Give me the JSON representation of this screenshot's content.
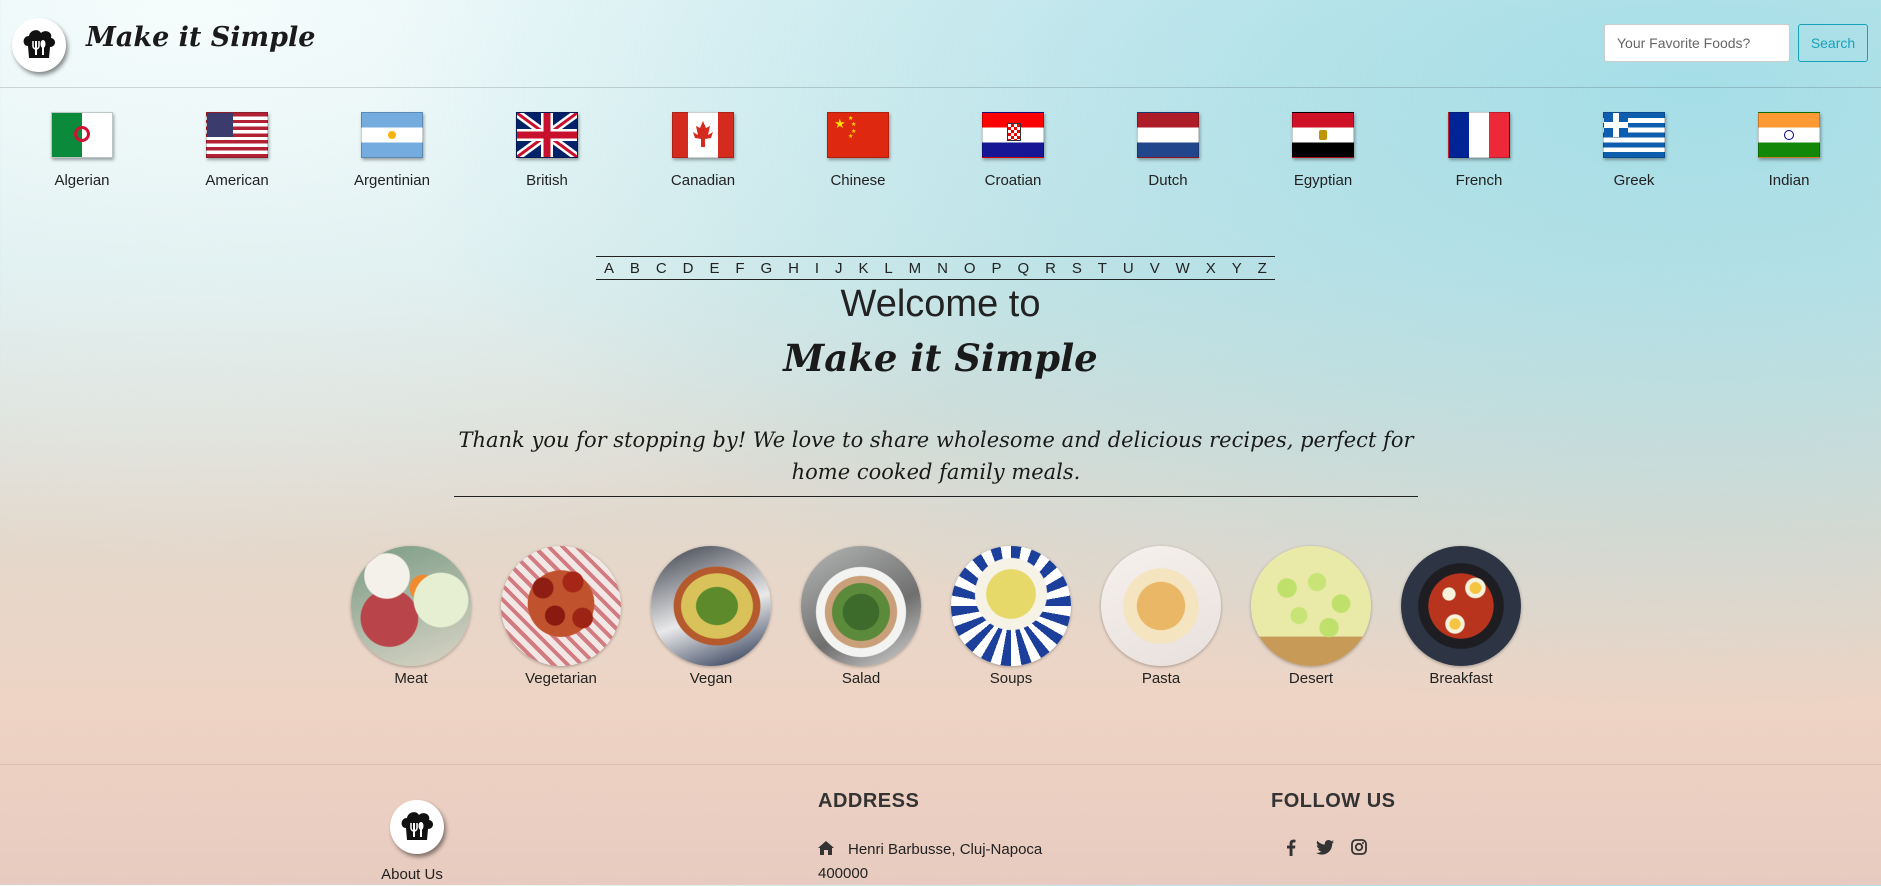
{
  "header": {
    "brand": "Make it Simple",
    "search_placeholder": "Your Favorite Foods?",
    "search_button": "Search"
  },
  "cuisines": [
    {
      "label": "Algerian",
      "flag": "algeria-flag-icon"
    },
    {
      "label": "American",
      "flag": "usa-flag-icon"
    },
    {
      "label": "Argentinian",
      "flag": "argentina-flag-icon"
    },
    {
      "label": "British",
      "flag": "uk-flag-icon"
    },
    {
      "label": "Canadian",
      "flag": "canada-flag-icon"
    },
    {
      "label": "Chinese",
      "flag": "china-flag-icon"
    },
    {
      "label": "Croatian",
      "flag": "croatia-flag-icon"
    },
    {
      "label": "Dutch",
      "flag": "netherlands-flag-icon"
    },
    {
      "label": "Egyptian",
      "flag": "egypt-flag-icon"
    },
    {
      "label": "French",
      "flag": "france-flag-icon"
    },
    {
      "label": "Greek",
      "flag": "greece-flag-icon"
    },
    {
      "label": "Indian",
      "flag": "india-flag-icon"
    }
  ],
  "alphabet": [
    "A",
    "B",
    "C",
    "D",
    "E",
    "F",
    "G",
    "H",
    "I",
    "J",
    "K",
    "L",
    "M",
    "N",
    "O",
    "P",
    "Q",
    "R",
    "S",
    "T",
    "U",
    "V",
    "W",
    "X",
    "Y",
    "Z"
  ],
  "hero": {
    "welcome": "Welcome to",
    "brand": "Make it Simple",
    "tagline": "Thank you for stopping by! We love to share wholesome and delicious recipes, perfect for home cooked family meals."
  },
  "categories": [
    {
      "label": "Meat"
    },
    {
      "label": "Vegetarian"
    },
    {
      "label": "Vegan"
    },
    {
      "label": "Salad"
    },
    {
      "label": "Soups"
    },
    {
      "label": "Pasta"
    },
    {
      "label": "Desert"
    },
    {
      "label": "Breakfast"
    }
  ],
  "footer": {
    "about": "About Us",
    "address_heading": "ADDRESS",
    "address_line1": "Henri Barbusse, Cluj-Napoca",
    "address_line2": "400000",
    "follow_heading": "FOLLOW US",
    "social": [
      "facebook-icon",
      "twitter-icon",
      "instagram-icon"
    ]
  },
  "colors": {
    "accent": "#17a2b8",
    "text": "#222222"
  }
}
